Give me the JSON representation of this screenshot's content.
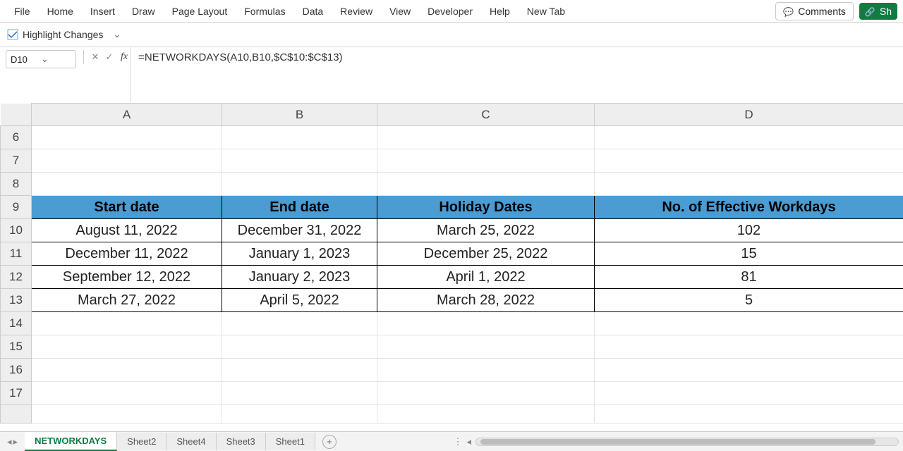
{
  "menu": {
    "items": [
      "File",
      "Home",
      "Insert",
      "Draw",
      "Page Layout",
      "Formulas",
      "Data",
      "Review",
      "View",
      "Developer",
      "Help",
      "New Tab"
    ]
  },
  "topright": {
    "comments": "Comments",
    "share": "Sh"
  },
  "quickbar": {
    "highlight_changes": "Highlight Changes"
  },
  "formula_bar": {
    "name_box": "D10",
    "fx_label": "fx",
    "formula": "=NETWORKDAYS(A10,B10,$C$10:$C$13)"
  },
  "columns": [
    "A",
    "B",
    "C",
    "D"
  ],
  "rows_visible": [
    "6",
    "7",
    "8",
    "9",
    "10",
    "11",
    "12",
    "13",
    "14",
    "15",
    "16",
    "17"
  ],
  "table": {
    "headers": [
      "Start date",
      "End date",
      "Holiday Dates",
      "No. of Effective Workdays"
    ],
    "rows": [
      {
        "start": "August 11, 2022",
        "end": "December 31, 2022",
        "holiday": "March 25, 2022",
        "work": "102"
      },
      {
        "start": "December 11, 2022",
        "end": "January 1, 2023",
        "holiday": "December 25, 2022",
        "work": "15"
      },
      {
        "start": "September 12, 2022",
        "end": "January 2, 2023",
        "holiday": "April 1, 2022",
        "work": "81"
      },
      {
        "start": "March 27, 2022",
        "end": "April 5, 2022",
        "holiday": "March 28, 2022",
        "work": "5"
      }
    ]
  },
  "sheets": {
    "active": "NETWORKDAYS",
    "tabs": [
      "NETWORKDAYS",
      "Sheet2",
      "Sheet4",
      "Sheet3",
      "Sheet1"
    ]
  }
}
